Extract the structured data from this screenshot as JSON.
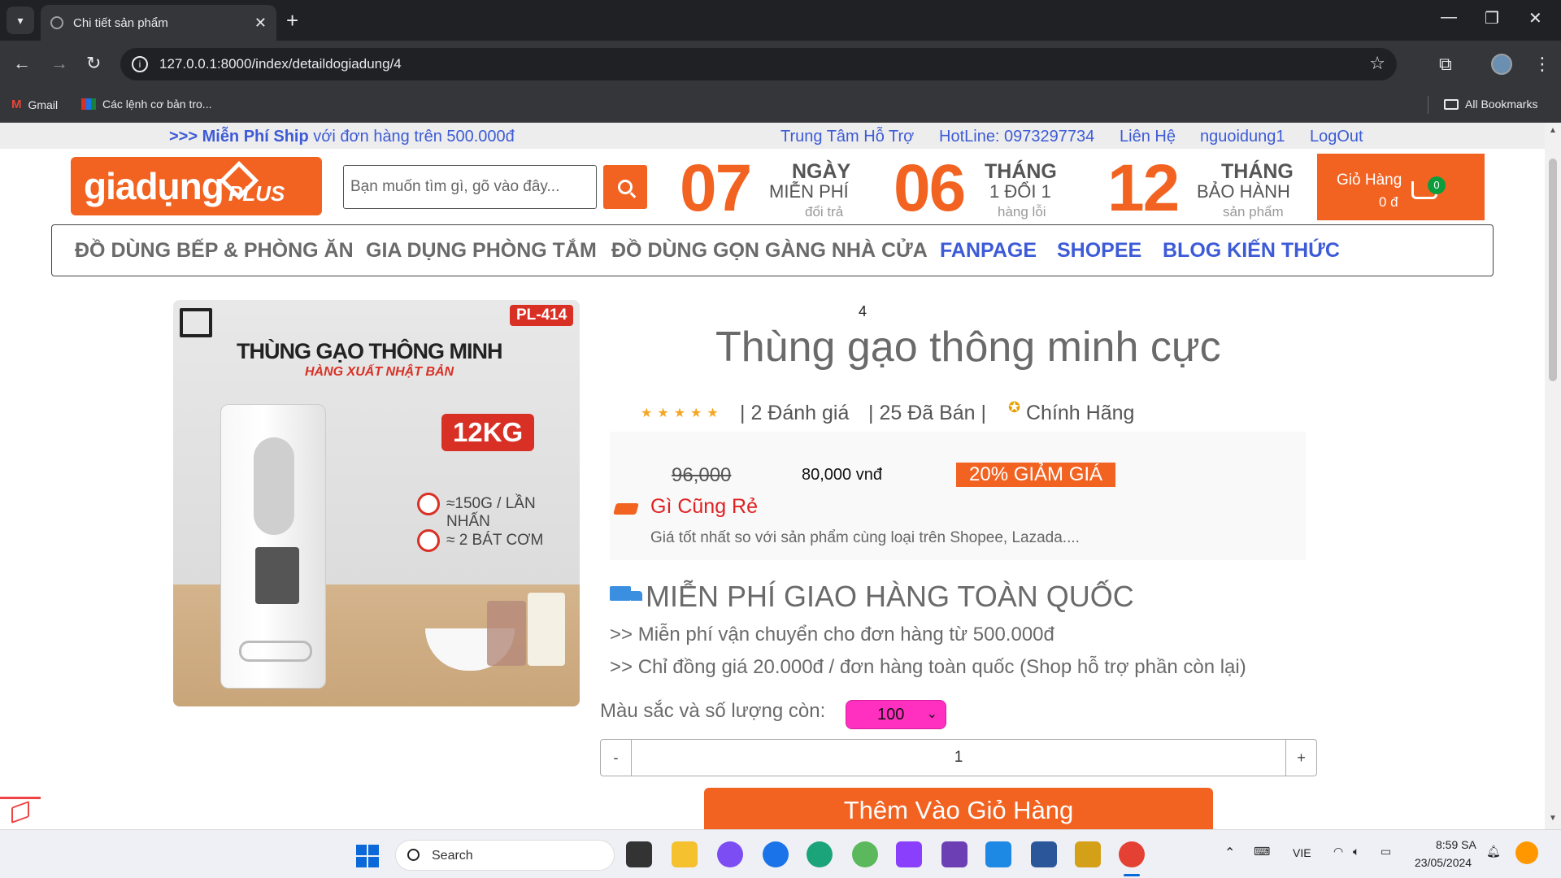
{
  "browser": {
    "tab_title": "Chi tiết sản phẩm",
    "url": "127.0.0.1:8000/index/detaildogiadung/4",
    "bookmarks": [
      {
        "label": "Gmail"
      },
      {
        "label": "Các lệnh cơ bản tro..."
      }
    ],
    "all_bookmarks": "All Bookmarks"
  },
  "topbar": {
    "promo_prefix": ">>> Miễn Phí Ship",
    "promo_suffix": "với đơn hàng trên 500.000đ",
    "links": [
      "Trung Tâm Hỗ Trợ",
      "HotLine: 0973297734",
      "Liên Hệ",
      "nguoidung1",
      "LogOut"
    ]
  },
  "header": {
    "logo_text": "giadụng",
    "logo_plus": "PLUS",
    "search_placeholder": "Bạn muốn tìm gì, gõ vào đây...",
    "features": [
      {
        "number": "07",
        "l1": "NGÀY",
        "l2": "MIỄN PHÍ",
        "l3": "đổi trả"
      },
      {
        "number": "06",
        "l1": "THÁNG",
        "l2": "1 ĐỔI 1",
        "l3": "hàng lỗi"
      },
      {
        "number": "12",
        "l1": "THÁNG",
        "l2": "BẢO HÀNH",
        "l3": "sản phẩm"
      }
    ],
    "cart_label": "Giỏ Hàng",
    "cart_amount": "0 đ",
    "cart_count": "0"
  },
  "nav": {
    "items": [
      "ĐỒ DÙNG BẾP & PHÒNG ĂN",
      "GIA DỤNG PHÒNG TẮM",
      "ĐỒ DÙNG GỌN GÀNG NHÀ CỬA",
      "FANPAGE",
      "SHOPEE",
      "BLOG KIẾN THỨC"
    ]
  },
  "product_image": {
    "code": "PL-414",
    "headline": "THÙNG GẠO THÔNG MINH",
    "subheadline": "HÀNG XUẤT NHẬT BẢN",
    "capacity": "12KG",
    "feature1": "≈150G / LẦN NHẤN",
    "feature2": "≈ 2 BÁT CƠM"
  },
  "product": {
    "id": "4",
    "title": "Thùng gạo thông minh cực",
    "stars": "★★★★★",
    "rating": "| 2 Đánh giá",
    "sold": "| 25 Đã Bán |",
    "genuine": "Chính Hãng",
    "old_price": "96,000",
    "new_price": "80,000 vnđ",
    "discount": "20% GIẢM GIÁ",
    "cheap_title": "Gì Cũng Rẻ",
    "cheap_desc": "Giá tốt nhất so với sản phẩm cùng loại trên Shopee, Lazada....",
    "ship_title": "MIỄN PHÍ GIAO HÀNG TOÀN QUỐC",
    "ship_line1": ">> Miễn phí vận chuyển cho đơn hàng từ 500.000đ",
    "ship_line2": ">> Chỉ đồng giá 20.000đ / đơn hàng toàn quốc (Shop hỗ trợ phần còn lại)",
    "color_label": "Màu sắc và số lượng còn:",
    "color_value": "100",
    "qty_minus": "-",
    "qty_value": "1",
    "qty_plus": "+",
    "add_to_cart": "Thêm Vào Giỏ Hàng"
  },
  "taskbar": {
    "search": "Search",
    "lang": "VIE",
    "time": "8:59 SA",
    "date": "23/05/2024"
  },
  "colors": {
    "brand_orange": "#f26322",
    "link_blue": "#3d5bd6",
    "select_pink": "#ff2fbf"
  }
}
